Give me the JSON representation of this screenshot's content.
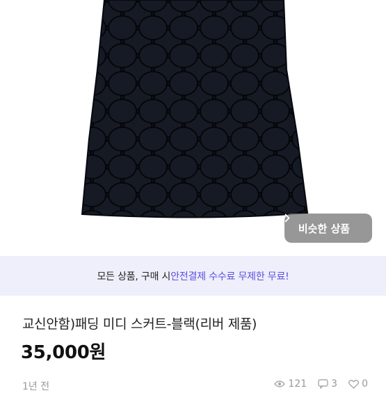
{
  "product": {
    "title": "교신안함)패딩 미디 스커트-블랙(리버 제품)",
    "price": "35,000원",
    "posted": "1년 전",
    "stats": {
      "views": "121",
      "chats": "3",
      "likes": "0"
    }
  },
  "image_overlay": {
    "similar_label": "비슷한 상품"
  },
  "banner": {
    "prefix": "모든 상품, 구매 시 ",
    "highlight": "안전결제 수수료 무제한 무료!"
  },
  "colors": {
    "accent": "#5a4fe0",
    "banner_bg": "#efeffb",
    "skirt": "#0e1018"
  }
}
